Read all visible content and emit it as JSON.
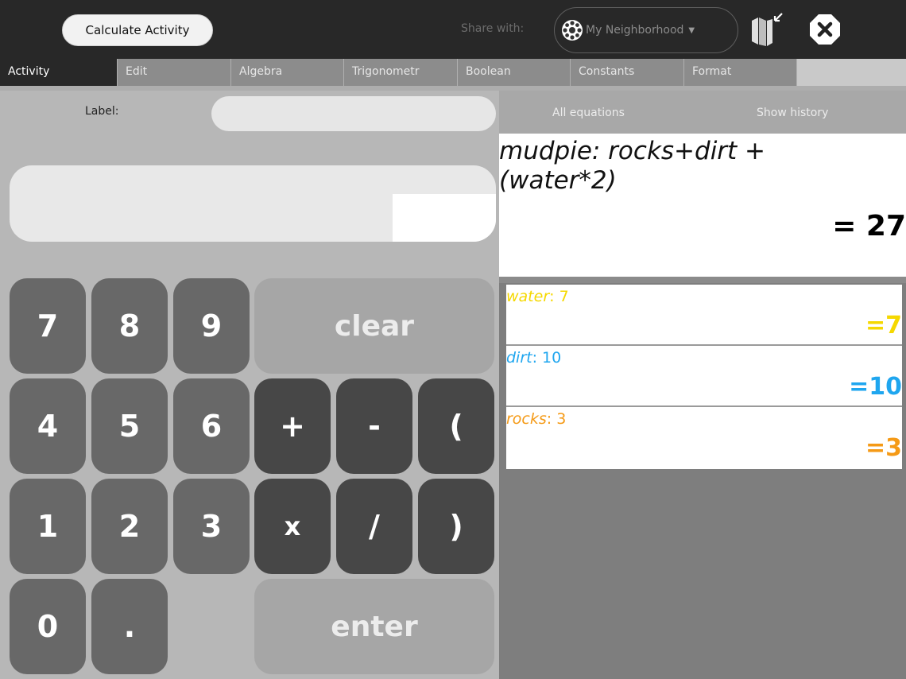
{
  "toolbar": {
    "activity_button": "Calculate Activity",
    "share_label": "Share with:",
    "share_value": "My Neighborhood"
  },
  "tabs": [
    {
      "label": "Activity"
    },
    {
      "label": "Edit"
    },
    {
      "label": "Algebra"
    },
    {
      "label": "Trigonometr"
    },
    {
      "label": "Boolean"
    },
    {
      "label": "Constants"
    },
    {
      "label": "Format"
    }
  ],
  "label_field": {
    "label": "Label:",
    "value": ""
  },
  "equation_input": {
    "value": ""
  },
  "keypad": {
    "k7": "7",
    "k8": "8",
    "k9": "9",
    "clear": "clear",
    "k4": "4",
    "k5": "5",
    "k6": "6",
    "plus": "+",
    "minus": "-",
    "lparen": "(",
    "k1": "1",
    "k2": "2",
    "k3": "3",
    "times": "x",
    "divide": "/",
    "rparen": ")",
    "k0": "0",
    "dot": ".",
    "enter": "enter"
  },
  "right": {
    "all_equations": "All equations",
    "show_history": "Show history",
    "main_equation": "mudpie: rocks+dirt +(water*2)",
    "main_result": "= 27"
  },
  "variables": [
    {
      "name": "water",
      "expr_rest": ": 7",
      "result": "=7",
      "color": "#f5d800"
    },
    {
      "name": "dirt",
      "expr_rest": ": 10",
      "result": "=10",
      "color": "#1fa6ef"
    },
    {
      "name": "rocks",
      "expr_rest": ": 3",
      "result": "=3",
      "color": "#f59a16"
    }
  ],
  "icons": {
    "neighborhood": "neighborhood-icon",
    "keep": "keep-icon",
    "stop": "stop-icon"
  }
}
